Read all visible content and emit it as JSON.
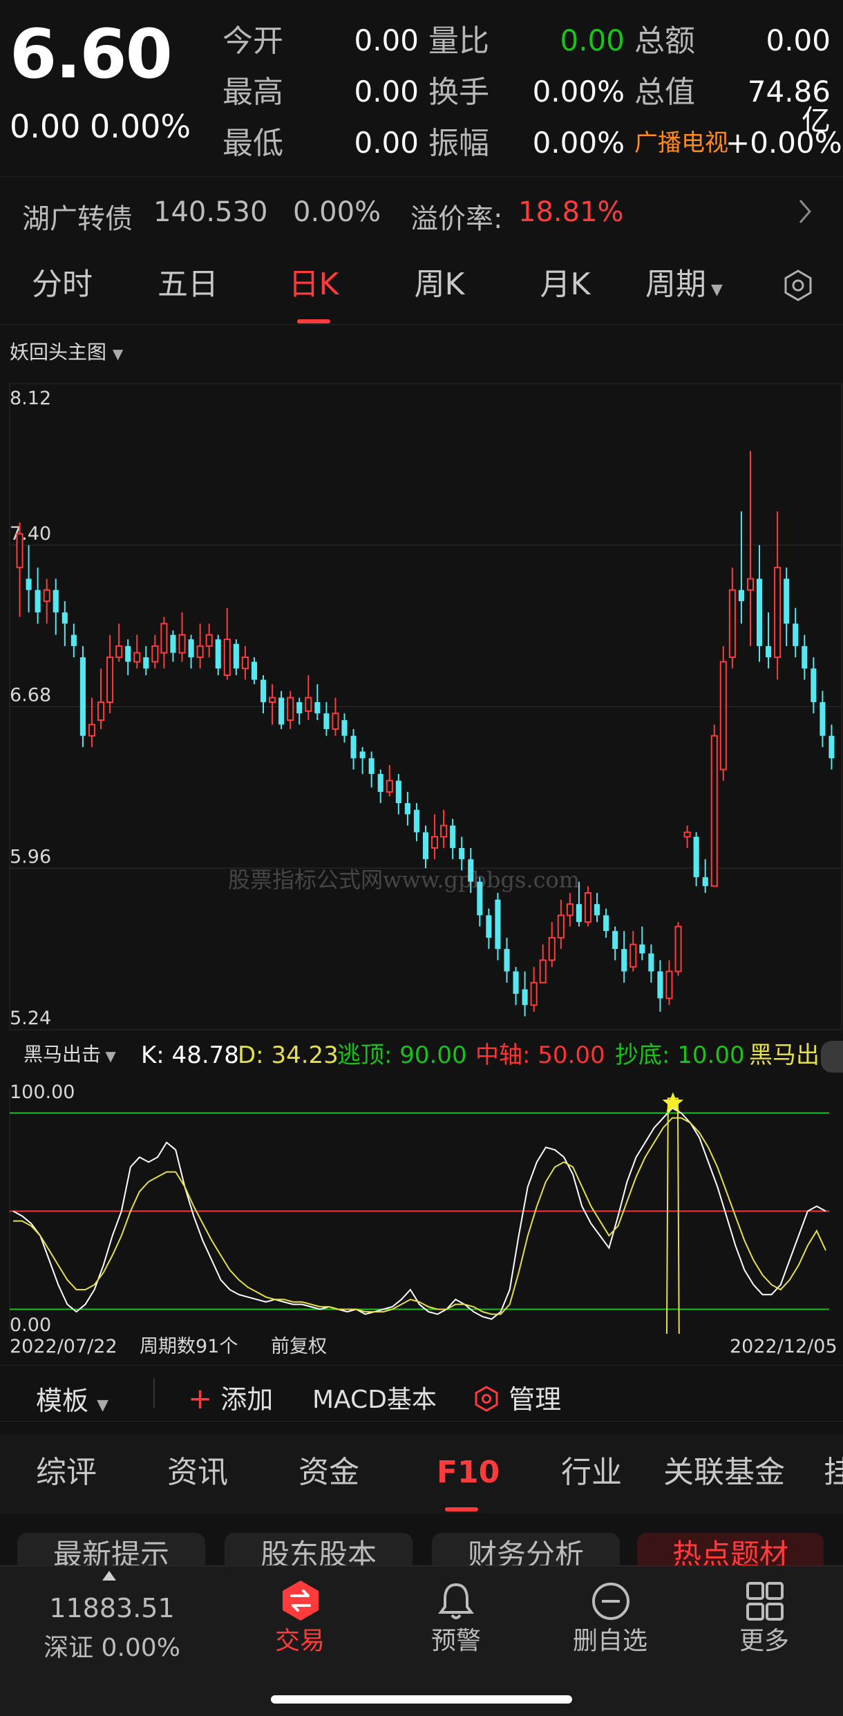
{
  "quote": {
    "price": "6.60",
    "change": "0.00",
    "change_pct": "0.00%",
    "rows": [
      {
        "l1": "今开",
        "v1": "0.00",
        "l2": "量比",
        "v2": "0.00",
        "l3": "总额",
        "v3": "0.00"
      },
      {
        "l1": "最高",
        "v1": "0.00",
        "l2": "换手",
        "v2": "0.00%",
        "l3": "总值",
        "v3": "74.86亿"
      },
      {
        "l1": "最低",
        "v1": "0.00",
        "l2": "振幅",
        "v2": "0.00%",
        "l3": "广播电视",
        "v3": "+0.00%"
      }
    ]
  },
  "convertible": {
    "name": "湖广转债",
    "price": "140.530",
    "pct": "0.00%",
    "premium_label": "溢价率:",
    "premium_value": "18.81%"
  },
  "period_tabs": [
    "分时",
    "五日",
    "日K",
    "周K",
    "月K",
    "周期"
  ],
  "active_tab": "日K",
  "main_chart_label": "妖回头主图",
  "watermark": "股票指标公式网www.gpbbgs.com",
  "indicator": {
    "name": "黑马出击",
    "items": [
      {
        "text": "K: 48.78",
        "color": "#ffffff"
      },
      {
        "text": "D: 34.23",
        "color": "#e6e04a"
      },
      {
        "text": "逃顶: 90.00",
        "color": "#19c319"
      },
      {
        "text": "中轴: 50.00",
        "color": "#ff3333"
      },
      {
        "text": "抄底: 10.00",
        "color": "#19c319"
      },
      {
        "text": "黑马出",
        "color": "#e6e04a"
      }
    ],
    "ytop": "100.00",
    "ybottom": "0.00"
  },
  "chart_footer": {
    "start_date": "2022/07/22",
    "count": "周期数91个",
    "adjust": "前复权",
    "end_date": "2022/12/05"
  },
  "toolbar": {
    "template": "模板",
    "add": "添加",
    "macd": "MACD基本",
    "manage": "管理"
  },
  "f10_tabs": [
    "综评",
    "资讯",
    "资金",
    "F10",
    "行业",
    "关联基金",
    "挂"
  ],
  "f10_active": "F10",
  "subtabs": [
    "最新提示",
    "股东股本",
    "财务分析",
    "热点题材"
  ],
  "bottom_nav": {
    "index_value": "11883.51",
    "index_label": "深证 0.00%",
    "items": [
      "交易",
      "预警",
      "删自选",
      "更多"
    ]
  },
  "colors": {
    "up": "#ff3b3b",
    "down": "#55e8f0",
    "accent": "#ff3b3b",
    "k_line": "#ffffff",
    "d_line": "#e6e04a"
  },
  "chart_data": [
    {
      "type": "candlestick",
      "title": "妖回头主图",
      "y_ticks": [
        "8.12",
        "7.40",
        "6.68",
        "5.96",
        "5.24"
      ],
      "ylim": [
        5.24,
        8.12
      ],
      "candles": [
        [
          7.3,
          7.45,
          7.5,
          7.08
        ],
        [
          7.25,
          7.2,
          7.4,
          7.1
        ],
        [
          7.2,
          7.1,
          7.3,
          7.05
        ],
        [
          7.15,
          7.2,
          7.25,
          7.05
        ],
        [
          7.2,
          7.1,
          7.25,
          7.0
        ],
        [
          7.1,
          7.05,
          7.15,
          6.95
        ],
        [
          7.0,
          6.95,
          7.05,
          6.9
        ],
        [
          6.9,
          6.55,
          6.95,
          6.5
        ],
        [
          6.55,
          6.6,
          6.72,
          6.5
        ],
        [
          6.62,
          6.7,
          6.85,
          6.58
        ],
        [
          6.7,
          6.9,
          7.0,
          6.65
        ],
        [
          6.9,
          6.95,
          7.05,
          6.88
        ],
        [
          6.95,
          6.88,
          6.98,
          6.82
        ],
        [
          6.88,
          6.92,
          7.0,
          6.85
        ],
        [
          6.9,
          6.85,
          6.95,
          6.82
        ],
        [
          6.88,
          6.95,
          7.0,
          6.85
        ],
        [
          6.92,
          7.05,
          7.08,
          6.85
        ],
        [
          7.0,
          6.92,
          7.02,
          6.88
        ],
        [
          6.92,
          7.0,
          7.1,
          6.88
        ],
        [
          6.98,
          6.9,
          7.0,
          6.85
        ],
        [
          6.9,
          6.95,
          7.05,
          6.85
        ],
        [
          6.95,
          7.0,
          7.05,
          6.9
        ],
        [
          6.98,
          6.85,
          7.0,
          6.82
        ],
        [
          6.82,
          6.98,
          7.12,
          6.8
        ],
        [
          6.96,
          6.85,
          6.98,
          6.82
        ],
        [
          6.85,
          6.9,
          6.95,
          6.8
        ],
        [
          6.88,
          6.8,
          6.9,
          6.78
        ],
        [
          6.8,
          6.7,
          6.82,
          6.65
        ],
        [
          6.7,
          6.72,
          6.78,
          6.6
        ],
        [
          6.72,
          6.6,
          6.75,
          6.58
        ],
        [
          6.62,
          6.72,
          6.75,
          6.58
        ],
        [
          6.7,
          6.65,
          6.72,
          6.6
        ],
        [
          6.66,
          6.72,
          6.82,
          6.62
        ],
        [
          6.7,
          6.65,
          6.78,
          6.62
        ],
        [
          6.65,
          6.58,
          6.7,
          6.55
        ],
        [
          6.58,
          6.65,
          6.72,
          6.55
        ],
        [
          6.62,
          6.55,
          6.65,
          6.52
        ],
        [
          6.55,
          6.45,
          6.58,
          6.4
        ],
        [
          6.48,
          6.45,
          6.5,
          6.38
        ],
        [
          6.45,
          6.38,
          6.48,
          6.32
        ],
        [
          6.38,
          6.3,
          6.4,
          6.25
        ],
        [
          6.3,
          6.35,
          6.42,
          6.28
        ],
        [
          6.35,
          6.25,
          6.38,
          6.2
        ],
        [
          6.25,
          6.2,
          6.3,
          6.15
        ],
        [
          6.22,
          6.12,
          6.25,
          6.08
        ],
        [
          6.12,
          6.0,
          6.15,
          5.96
        ],
        [
          6.05,
          6.1,
          6.2,
          6.0
        ],
        [
          6.1,
          6.15,
          6.22,
          6.05
        ],
        [
          6.15,
          6.05,
          6.18,
          6.0
        ],
        [
          6.05,
          6.0,
          6.1,
          5.95
        ],
        [
          6.0,
          5.9,
          6.05,
          5.85
        ],
        [
          5.9,
          5.75,
          5.92,
          5.7
        ],
        [
          5.75,
          5.65,
          5.78,
          5.6
        ],
        [
          5.82,
          5.6,
          5.85,
          5.55
        ],
        [
          5.6,
          5.5,
          5.65,
          5.45
        ],
        [
          5.5,
          5.4,
          5.52,
          5.35
        ],
        [
          5.42,
          5.35,
          5.5,
          5.3
        ],
        [
          5.35,
          5.45,
          5.52,
          5.32
        ],
        [
          5.45,
          5.55,
          5.62,
          5.45
        ],
        [
          5.55,
          5.65,
          5.72,
          5.52
        ],
        [
          5.65,
          5.75,
          5.82,
          5.6
        ],
        [
          5.75,
          5.8,
          5.85,
          5.7
        ],
        [
          5.8,
          5.72,
          5.9,
          5.7
        ],
        [
          5.72,
          5.85,
          5.88,
          5.7
        ],
        [
          5.8,
          5.75,
          5.85,
          5.72
        ],
        [
          5.75,
          5.68,
          5.78,
          5.65
        ],
        [
          5.68,
          5.6,
          5.7,
          5.55
        ],
        [
          5.6,
          5.5,
          5.68,
          5.45
        ],
        [
          5.52,
          5.62,
          5.68,
          5.5
        ],
        [
          5.62,
          5.58,
          5.7,
          5.55
        ],
        [
          5.58,
          5.5,
          5.62,
          5.45
        ],
        [
          5.5,
          5.38,
          5.55,
          5.32
        ],
        [
          5.38,
          5.5,
          5.55,
          5.35
        ],
        [
          5.5,
          5.7,
          5.72,
          5.48
        ],
        [
          6.1,
          6.12,
          6.15,
          6.05
        ],
        [
          6.1,
          5.92,
          6.12,
          5.88
        ],
        [
          5.92,
          5.88,
          6.0,
          5.85
        ],
        [
          5.88,
          6.55,
          6.6,
          5.88
        ],
        [
          6.4,
          6.88,
          6.95,
          6.35
        ],
        [
          6.9,
          7.2,
          7.3,
          6.85
        ],
        [
          7.2,
          7.15,
          7.55,
          7.05
        ],
        [
          7.2,
          7.25,
          7.82,
          6.95
        ],
        [
          7.25,
          6.95,
          7.4,
          6.88
        ],
        [
          6.95,
          6.9,
          7.1,
          6.85
        ],
        [
          6.9,
          7.3,
          7.55,
          6.8
        ],
        [
          7.25,
          7.05,
          7.3,
          6.95
        ],
        [
          7.05,
          6.95,
          7.12,
          6.9
        ],
        [
          6.95,
          6.85,
          7.0,
          6.8
        ],
        [
          6.85,
          6.7,
          6.9,
          6.65
        ],
        [
          6.7,
          6.55,
          6.75,
          6.5
        ],
        [
          6.55,
          6.45,
          6.6,
          6.4
        ]
      ]
    },
    {
      "type": "line",
      "title": "黑马出击",
      "ylim": [
        0,
        100
      ],
      "lines": {
        "逃顶": 90,
        "中轴": 50,
        "抄底": 10
      },
      "series": [
        {
          "name": "K",
          "values": [
            50,
            48,
            45,
            40,
            30,
            20,
            12,
            9,
            12,
            18,
            28,
            40,
            50,
            68,
            72,
            70,
            72,
            78,
            75,
            60,
            48,
            38,
            30,
            22,
            18,
            16,
            15,
            14,
            13,
            14,
            13,
            12,
            12,
            11,
            10,
            11,
            10,
            9,
            10,
            8,
            9,
            10,
            11,
            14,
            18,
            12,
            9,
            8,
            10,
            14,
            12,
            9,
            7,
            6,
            9,
            18,
            40,
            60,
            70,
            76,
            75,
            72,
            65,
            52,
            45,
            40,
            35,
            48,
            62,
            72,
            78,
            84,
            88,
            92,
            90,
            86,
            80,
            70,
            60,
            48,
            36,
            26,
            20,
            16,
            16,
            20,
            30,
            40,
            50,
            52,
            50
          ]
        },
        {
          "name": "D",
          "values": [
            46,
            46,
            44,
            40,
            34,
            28,
            22,
            18,
            18,
            20,
            25,
            32,
            40,
            50,
            58,
            62,
            64,
            66,
            66,
            60,
            52,
            45,
            38,
            32,
            26,
            22,
            19,
            17,
            15,
            14,
            14,
            13,
            13,
            12,
            11,
            11,
            10,
            10,
            10,
            9,
            9,
            9,
            10,
            12,
            14,
            13,
            11,
            10,
            10,
            12,
            12,
            11,
            9,
            8,
            8,
            12,
            25,
            40,
            52,
            62,
            68,
            70,
            68,
            60,
            52,
            46,
            40,
            44,
            54,
            64,
            72,
            78,
            84,
            88,
            88,
            86,
            82,
            76,
            68,
            58,
            48,
            38,
            30,
            24,
            20,
            18,
            22,
            28,
            36,
            42,
            34
          ]
        }
      ],
      "x_start": "2022/07/22",
      "x_end": "2022/12/05"
    }
  ]
}
